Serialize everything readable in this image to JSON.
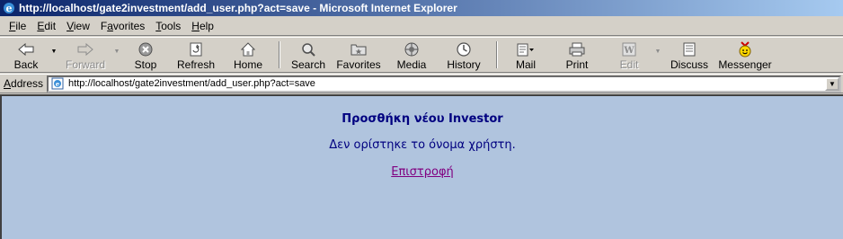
{
  "window": {
    "title": "http://localhost/gate2investment/add_user.php?act=save - Microsoft Internet Explorer"
  },
  "menu": [
    {
      "pre": "",
      "ul": "F",
      "post": "ile"
    },
    {
      "pre": "",
      "ul": "E",
      "post": "dit"
    },
    {
      "pre": "",
      "ul": "V",
      "post": "iew"
    },
    {
      "pre": "F",
      "ul": "a",
      "post": "vorites"
    },
    {
      "pre": "",
      "ul": "T",
      "post": "ools"
    },
    {
      "pre": "",
      "ul": "H",
      "post": "elp"
    }
  ],
  "toolbar": {
    "back": "Back",
    "forward": "Forward",
    "stop": "Stop",
    "refresh": "Refresh",
    "home": "Home",
    "search": "Search",
    "favorites": "Favorites",
    "media": "Media",
    "history": "History",
    "mail": "Mail",
    "print": "Print",
    "edit": "Edit",
    "discuss": "Discuss",
    "messenger": "Messenger"
  },
  "address": {
    "label_ul": "A",
    "label_rest": "ddress",
    "url": "http://localhost/gate2investment/add_user.php?act=save"
  },
  "page": {
    "heading": "Προσθήκη νέου Investor",
    "message": "Δεν ορίστηκε το όνομα χρήστη.",
    "link": "Επιστροφή"
  }
}
